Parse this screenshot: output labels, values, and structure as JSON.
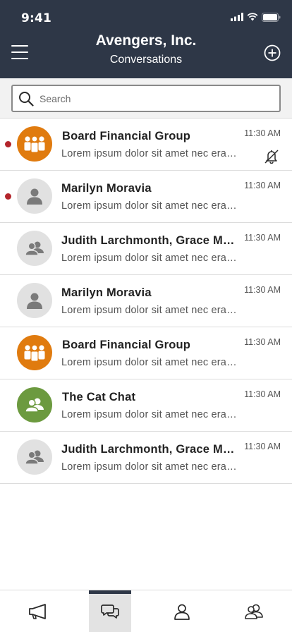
{
  "status_bar": {
    "time": "9:41"
  },
  "header": {
    "title": "Avengers, Inc.",
    "subtitle": "Conversations",
    "icons": {
      "menu": "hamburger-menu-icon",
      "add": "plus-circle-icon"
    },
    "background": "#2e3747"
  },
  "search": {
    "placeholder": "Search",
    "value": ""
  },
  "conversations": [
    {
      "name": "Board Financial Group",
      "preview": "Lorem ipsum dolor sit amet nec eran…",
      "time": "11:30 AM",
      "unread": true,
      "muted": true,
      "avatar": "group-orange"
    },
    {
      "name": "Marilyn Moravia",
      "preview": "Lorem ipsum dolor sit amet nec eran…",
      "time": "11:30 AM",
      "unread": true,
      "muted": false,
      "avatar": "person-gray"
    },
    {
      "name": "Judith Larchmonth, Grace M…",
      "preview": "Lorem ipsum dolor sit amet nec eran…",
      "time": "11:30 AM",
      "unread": false,
      "muted": false,
      "avatar": "pair-gray"
    },
    {
      "name": "Marilyn Moravia",
      "preview": "Lorem ipsum dolor sit amet nec eran…",
      "time": "11:30 AM",
      "unread": false,
      "muted": false,
      "avatar": "person-gray"
    },
    {
      "name": "Board Financial Group",
      "preview": "Lorem ipsum dolor sit amet nec eran…",
      "time": "11:30 AM",
      "unread": false,
      "muted": false,
      "avatar": "group-orange"
    },
    {
      "name": "The Cat Chat",
      "preview": "Lorem ipsum dolor sit amet nec eran…",
      "time": "11:30 AM",
      "unread": false,
      "muted": false,
      "avatar": "pair-green"
    },
    {
      "name": "Judith Larchmonth, Grace M…",
      "preview": "Lorem ipsum dolor sit amet nec eran…",
      "time": "11:30 AM",
      "unread": false,
      "muted": false,
      "avatar": "pair-gray"
    }
  ],
  "tabbar": {
    "tabs": [
      {
        "id": "announcements",
        "icon": "megaphone-icon",
        "active": false
      },
      {
        "id": "conversations",
        "icon": "chat-bubbles-icon",
        "active": true
      },
      {
        "id": "contacts",
        "icon": "person-icon",
        "active": false
      },
      {
        "id": "people",
        "icon": "people-icon",
        "active": false
      }
    ]
  },
  "colors": {
    "accent": "#2e3747",
    "unread": "#b3252b",
    "orange": "#e07b0f",
    "green": "#6c9a3f",
    "avatar_gray": "#e1e1e1"
  }
}
